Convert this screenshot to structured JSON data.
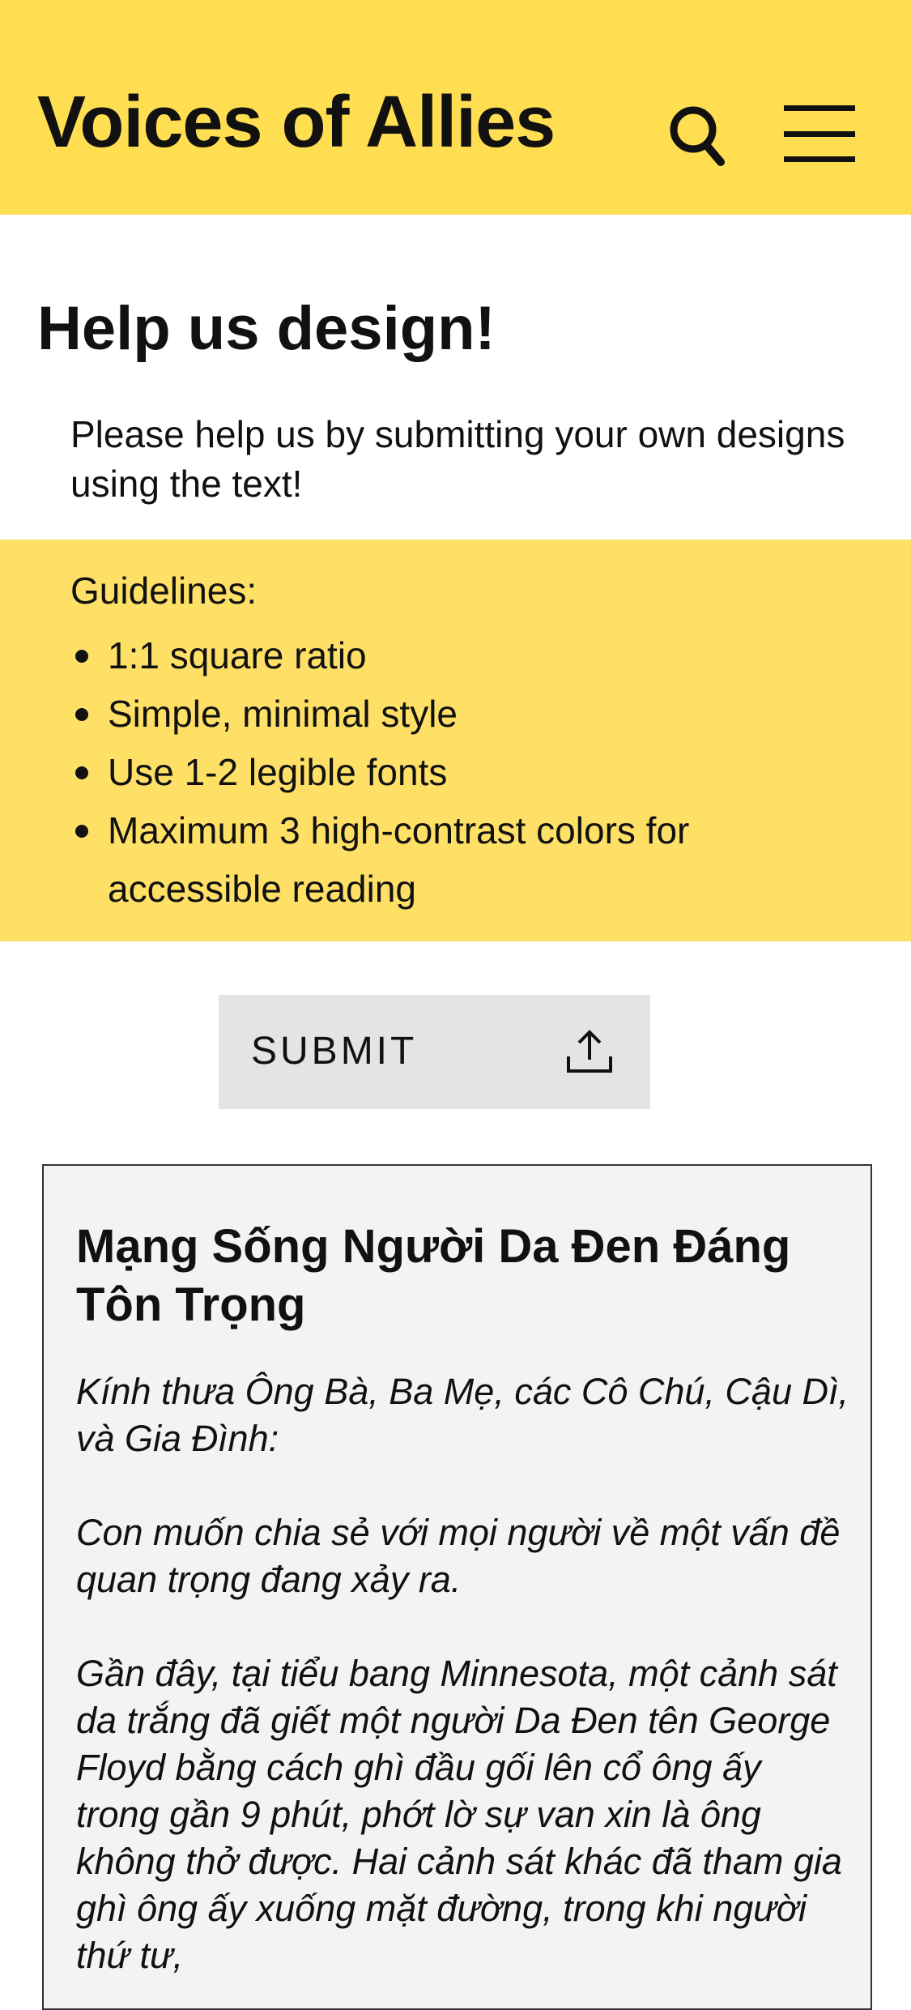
{
  "header": {
    "title": "Voices of Allies",
    "search_icon": "search-icon",
    "menu_icon": "hamburger-menu-icon",
    "background_color": "#FFDE52"
  },
  "help": {
    "title": "Help us design!",
    "description": "Please help us by submitting your own designs using the text!"
  },
  "guidelines": {
    "title": "Guidelines:",
    "items": [
      "1:1 square ratio",
      "Simple, minimal style",
      "Use 1-2 legible fonts",
      "Maximum 3 high-contrast colors for accessible reading"
    ],
    "background_color": "#FFE066"
  },
  "submit": {
    "label": "SUBMIT",
    "icon": "upload-icon"
  },
  "letter": {
    "title": "Mạng Sống Người Da Đen Đáng Tôn Trọng",
    "paragraphs": [
      "Kính thưa Ông Bà, Ba Mẹ, các Cô Chú, Cậu Dì, và Gia Đình:",
      "Con muốn chia sẻ với mọi người về một vấn đề quan trọng đang xảy ra.",
      "Gần đây, tại tiểu bang Minnesota, một cảnh sát da trắng đã giết một người Da Đen tên George Floyd bằng cách ghì đầu gối lên cổ ông ấy trong gần 9 phút, phớt lờ sự van xin là ông không thở được. Hai cảnh sát khác đã tham gia ghì ông ấy xuống mặt đường, trong khi người thứ tư,"
    ]
  }
}
